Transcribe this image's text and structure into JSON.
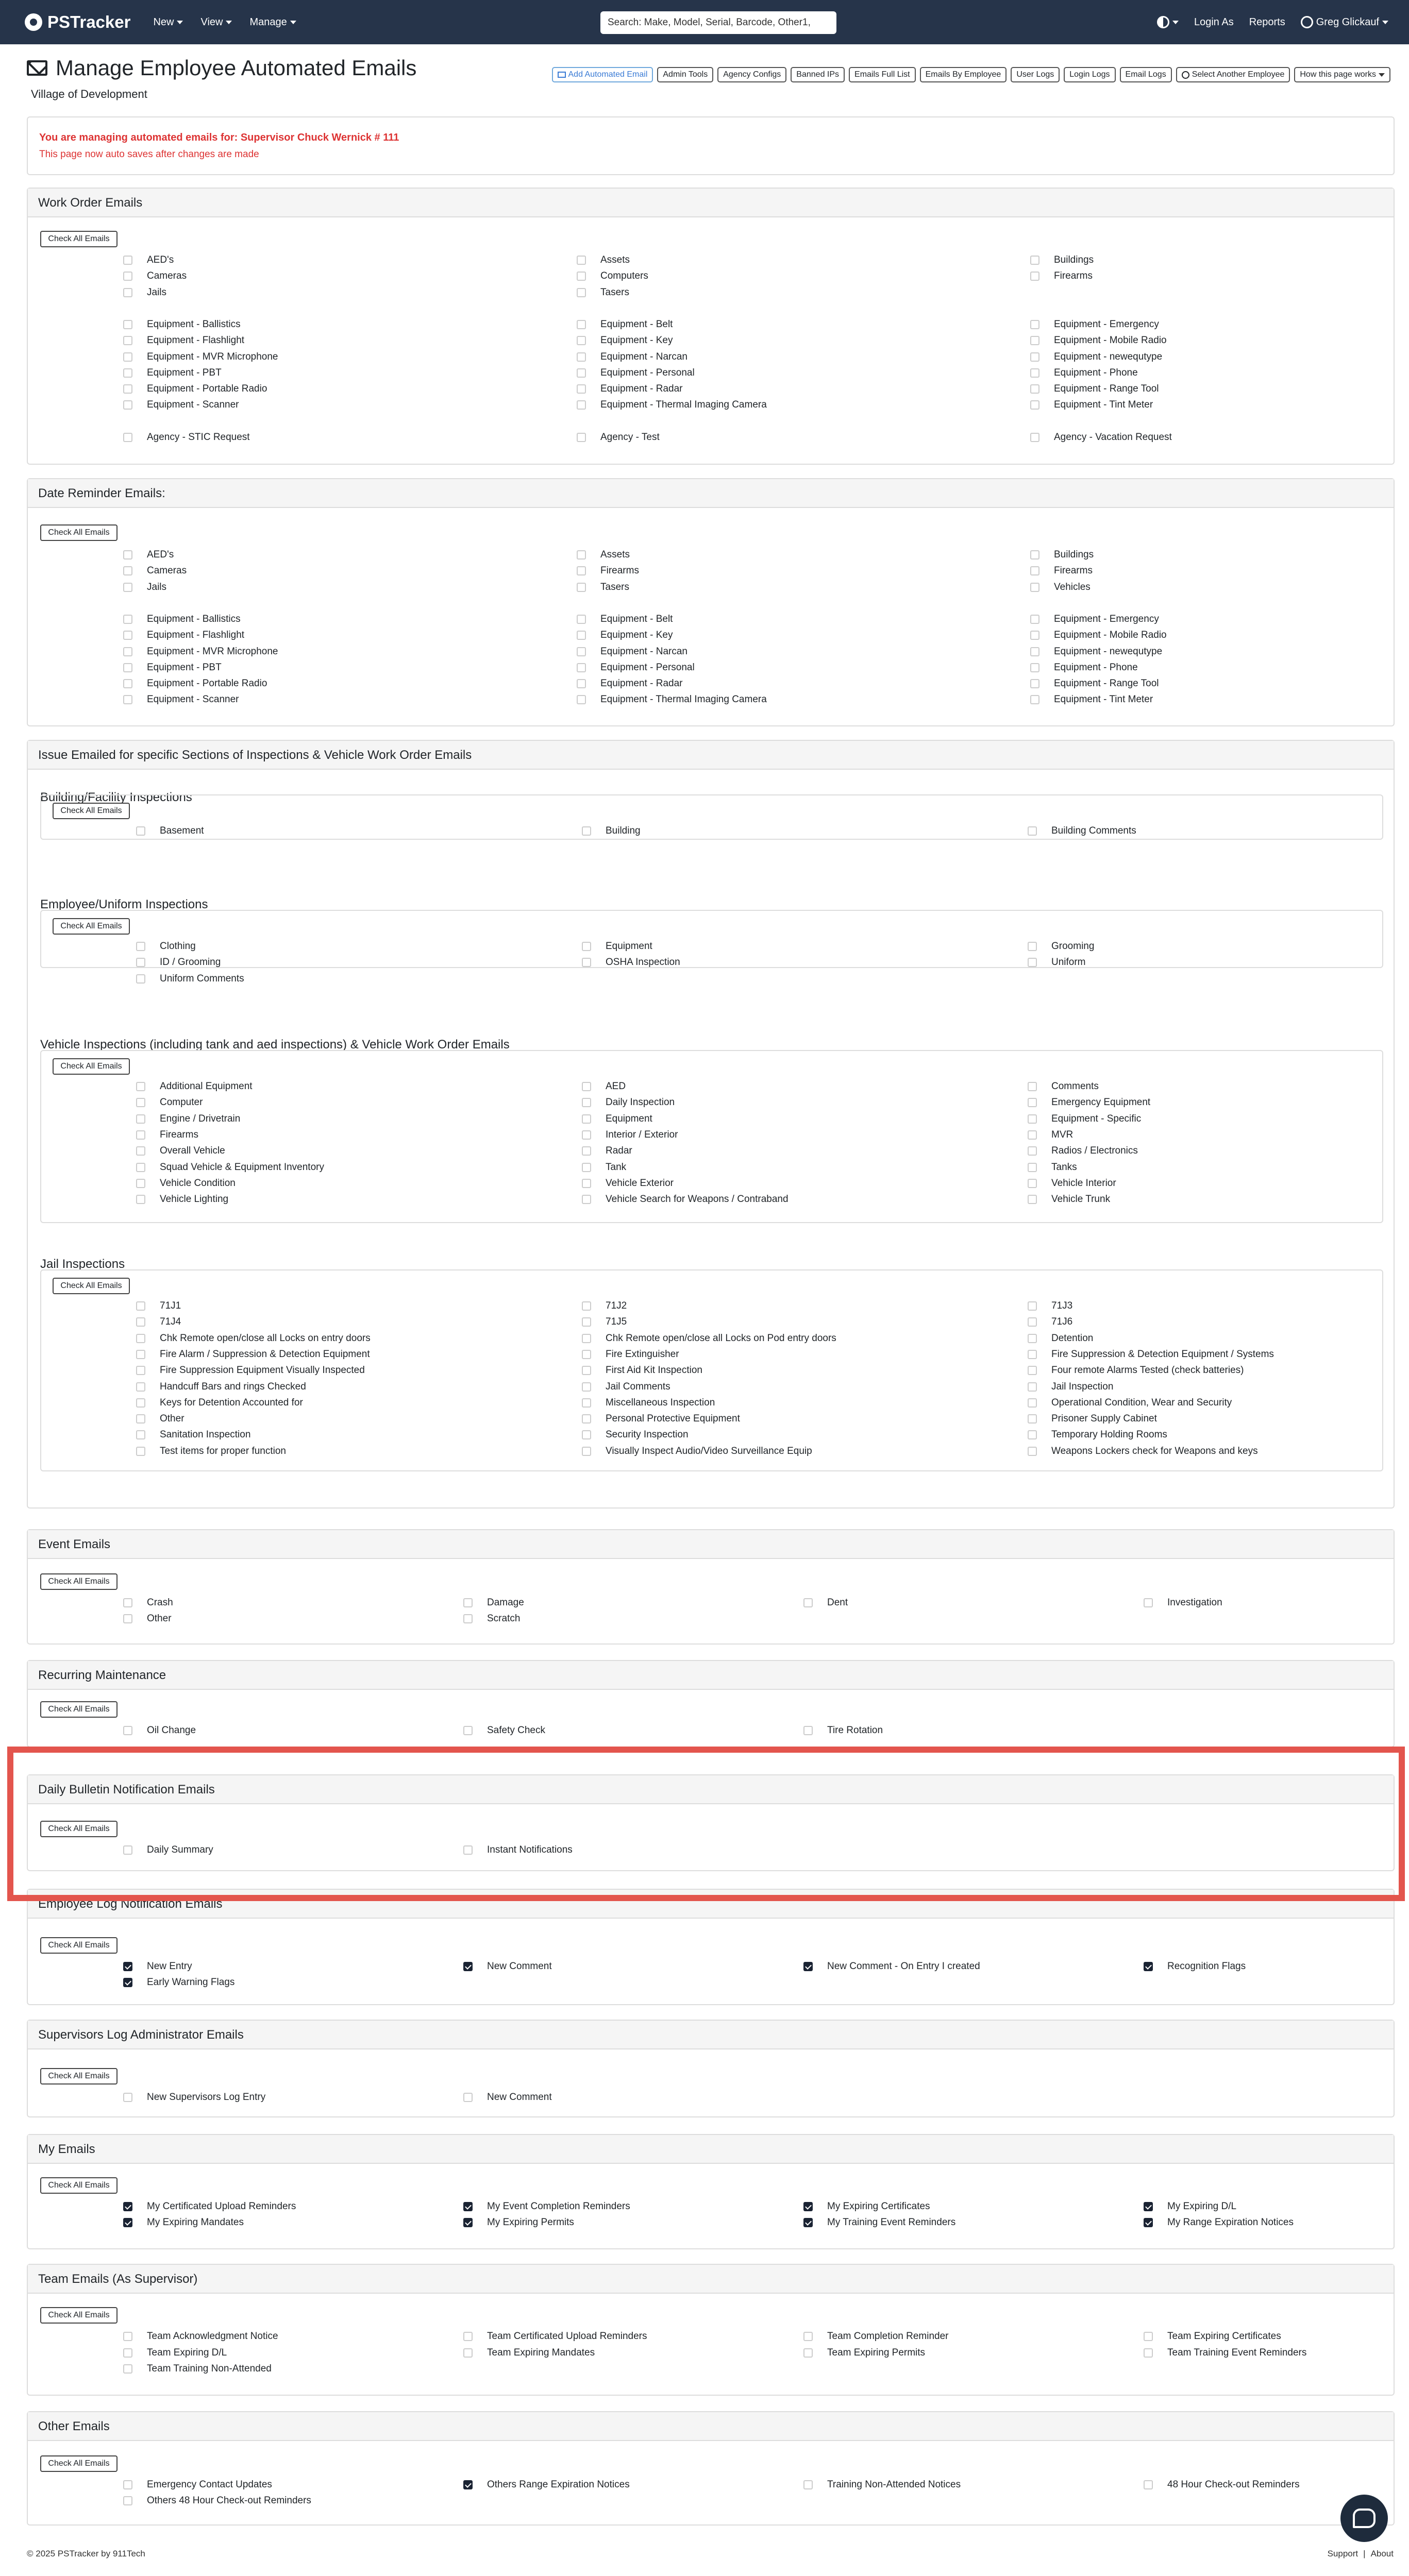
{
  "nav": {
    "brand": "PSTracker",
    "menus": [
      "New",
      "View",
      "Manage"
    ],
    "search_placeholder": "Search: Make, Model, Serial, Barcode, Other1,",
    "login_as": "Login As",
    "reports": "Reports",
    "user": "Greg Glickauf",
    "bg_color": "#26344a"
  },
  "page": {
    "title": "Manage Employee Automated Emails",
    "org": "Village of Development",
    "toolbar": [
      "Add Automated Email",
      "Admin Tools",
      "Agency Configs",
      "Banned IPs",
      "Emails Full List",
      "Emails By Employee",
      "User Logs",
      "Login Logs",
      "Email Logs",
      "Select Another Employee",
      "How this page works"
    ],
    "alert_line1": "You are managing automated emails for: Supervisor Chuck Wernick # 111",
    "alert_line2": "This page now auto saves after changes are made",
    "check_all": "Check All Emails",
    "alert_color": "#dd3333",
    "highlight_color": "#e3554d"
  },
  "sections": {
    "work_order": {
      "title": "Work Order Emails",
      "rows": [
        [
          "AED's",
          "Assets",
          "Buildings"
        ],
        [
          "Cameras",
          "Computers",
          "Firearms"
        ],
        [
          "Jails",
          "Tasers",
          ""
        ],
        [
          "Equipment - Ballistics",
          "Equipment - Belt",
          "Equipment - Emergency"
        ],
        [
          "Equipment - Flashlight",
          "Equipment - Key",
          "Equipment - Mobile Radio"
        ],
        [
          "Equipment - MVR Microphone",
          "Equipment - Narcan",
          "Equipment - newequtype"
        ],
        [
          "Equipment - PBT",
          "Equipment - Personal",
          "Equipment - Phone"
        ],
        [
          "Equipment - Portable Radio",
          "Equipment - Radar",
          "Equipment - Range Tool"
        ],
        [
          "Equipment - Scanner",
          "Equipment - Thermal Imaging Camera",
          "Equipment - Tint Meter"
        ],
        [
          "Agency - STIC Request",
          "Agency - Test",
          "Agency - Vacation Request"
        ]
      ]
    },
    "date_reminder": {
      "title": "Date Reminder Emails:",
      "rows": [
        [
          "AED's",
          "Assets",
          "Buildings"
        ],
        [
          "Cameras",
          "Firearms",
          "Firearms"
        ],
        [
          "Jails",
          "Tasers",
          "Vehicles"
        ],
        [
          "Equipment - Ballistics",
          "Equipment - Belt",
          "Equipment - Emergency"
        ],
        [
          "Equipment - Flashlight",
          "Equipment - Key",
          "Equipment - Mobile Radio"
        ],
        [
          "Equipment - MVR Microphone",
          "Equipment - Narcan",
          "Equipment - newequtype"
        ],
        [
          "Equipment - PBT",
          "Equipment - Personal",
          "Equipment - Phone"
        ],
        [
          "Equipment - Portable Radio",
          "Equipment - Radar",
          "Equipment - Range Tool"
        ],
        [
          "Equipment - Scanner",
          "Equipment - Thermal Imaging Camera",
          "Equipment - Tint Meter"
        ]
      ]
    },
    "issue": {
      "title": "Issue Emailed for specific Sections of Inspections & Vehicle Work Order Emails",
      "building": {
        "title": "Building/Facility Inspections",
        "rows": [
          [
            "Basement",
            "Building",
            "Building Comments"
          ]
        ]
      },
      "employee": {
        "title": "Employee/Uniform Inspections",
        "rows": [
          [
            "Clothing",
            "Equipment",
            "Grooming"
          ],
          [
            "ID / Grooming",
            "OSHA Inspection",
            "Uniform"
          ],
          [
            "Uniform Comments",
            "",
            ""
          ]
        ]
      },
      "vehicle": {
        "title": "Vehicle Inspections (including tank and aed inspections) & Vehicle Work Order Emails",
        "rows": [
          [
            "Additional Equipment",
            "AED",
            "Comments"
          ],
          [
            "Computer",
            "Daily Inspection",
            "Emergency Equipment"
          ],
          [
            "Engine / Drivetrain",
            "Equipment",
            "Equipment - Specific"
          ],
          [
            "Firearms",
            "Interior / Exterior",
            "MVR"
          ],
          [
            "Overall Vehicle",
            "Radar",
            "Radios / Electronics"
          ],
          [
            "Squad Vehicle & Equipment Inventory",
            "Tank",
            "Tanks"
          ],
          [
            "Vehicle Condition",
            "Vehicle Exterior",
            "Vehicle Interior"
          ],
          [
            "Vehicle Lighting",
            "Vehicle Search for Weapons / Contraband",
            "Vehicle Trunk"
          ]
        ]
      },
      "jail": {
        "title": "Jail Inspections",
        "rows": [
          [
            "71J1",
            "71J2",
            "71J3"
          ],
          [
            "71J4",
            "71J5",
            "71J6"
          ],
          [
            "Chk Remote open/close all Locks on entry doors",
            "Chk Remote open/close all Locks on Pod entry doors",
            "Detention"
          ],
          [
            "Fire Alarm / Suppression & Detection Equipment",
            "Fire Extinguisher",
            "Fire Suppression & Detection Equipment / Systems"
          ],
          [
            "Fire Suppression Equipment Visually Inspected",
            "First Aid Kit Inspection",
            "Four remote Alarms Tested (check batteries)"
          ],
          [
            "Handcuff Bars and rings Checked",
            "Jail Comments",
            "Jail Inspection"
          ],
          [
            "Keys for Detention Accounted for",
            "Miscellaneous Inspection",
            "Operational Condition, Wear and Security"
          ],
          [
            "Other",
            "Personal Protective Equipment",
            "Prisoner Supply Cabinet"
          ],
          [
            "Sanitation Inspection",
            "Security Inspection",
            "Temporary Holding Rooms"
          ],
          [
            "Test items for proper function",
            "Visually Inspect Audio/Video Surveillance Equip",
            "Weapons Lockers check for Weapons and keys"
          ]
        ]
      }
    },
    "event": {
      "title": "Event Emails",
      "rows": [
        [
          [
            "Crash",
            false
          ],
          [
            "Damage",
            false
          ],
          [
            "Dent",
            false
          ],
          [
            "Investigation",
            false
          ]
        ],
        [
          [
            "Other",
            false
          ],
          [
            "Scratch",
            false
          ]
        ]
      ]
    },
    "recurring": {
      "title": "Recurring Maintenance",
      "rows": [
        [
          [
            "Oil Change",
            false
          ],
          [
            "Safety Check",
            false
          ],
          [
            "Tire Rotation",
            false
          ]
        ]
      ]
    },
    "bulletin": {
      "title": "Daily Bulletin Notification Emails",
      "rows": [
        [
          [
            "Daily Summary",
            false
          ],
          [
            "Instant Notifications",
            false
          ]
        ]
      ]
    },
    "employee_log": {
      "title": "Employee Log Notification Emails",
      "rows": [
        [
          [
            "New Entry",
            true
          ],
          [
            "New Comment",
            true
          ],
          [
            "New Comment - On Entry I created",
            true
          ],
          [
            "Recognition Flags",
            true
          ]
        ],
        [
          [
            "Early Warning Flags",
            true
          ]
        ]
      ]
    },
    "supervisor_log": {
      "title": "Supervisors Log Administrator Emails",
      "rows": [
        [
          [
            "New Supervisors Log Entry",
            false
          ],
          [
            "New Comment",
            false
          ]
        ]
      ]
    },
    "my_emails": {
      "title": "My Emails",
      "rows": [
        [
          [
            "My Certificated Upload Reminders",
            true
          ],
          [
            "My Event Completion Reminders",
            true
          ],
          [
            "My Expiring Certificates",
            true
          ],
          [
            "My Expiring D/L",
            true
          ]
        ],
        [
          [
            "My Expiring Mandates",
            true
          ],
          [
            "My Expiring Permits",
            true
          ],
          [
            "My Training Event Reminders",
            true
          ],
          [
            "My Range Expiration Notices",
            true
          ]
        ]
      ]
    },
    "team": {
      "title": "Team Emails (As Supervisor)",
      "rows": [
        [
          [
            "Team Acknowledgment Notice",
            false
          ],
          [
            "Team Certificated Upload Reminders",
            false
          ],
          [
            "Team Completion Reminder",
            false
          ],
          [
            "Team Expiring Certificates",
            false
          ]
        ],
        [
          [
            "Team Expiring D/L",
            false
          ],
          [
            "Team Expiring Mandates",
            false
          ],
          [
            "Team Expiring Permits",
            false
          ],
          [
            "Team Training Event Reminders",
            false
          ]
        ],
        [
          [
            "Team Training Non-Attended",
            false
          ]
        ]
      ]
    },
    "other": {
      "title": "Other Emails",
      "rows": [
        [
          [
            "Emergency Contact Updates",
            false
          ],
          [
            "Others Range Expiration Notices",
            true
          ],
          [
            "Training Non-Attended Notices",
            false
          ],
          [
            "48 Hour Check-out Reminders",
            false
          ]
        ],
        [
          [
            "Others 48 Hour Check-out Reminders",
            false
          ]
        ]
      ]
    }
  },
  "footer": {
    "left": "© 2025 PSTracker by 911Tech",
    "support": "Support",
    "sep": "|",
    "about": "About"
  }
}
